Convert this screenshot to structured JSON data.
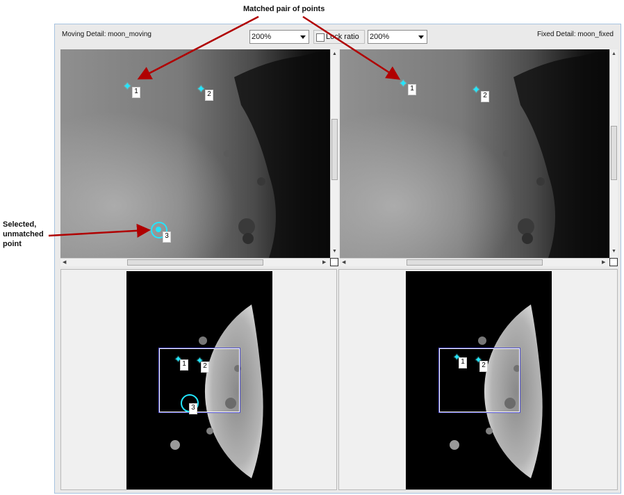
{
  "callouts": {
    "matched": "Matched pair of points",
    "selected_line1": "Selected,",
    "selected_line2": "unmatched",
    "selected_line3": "point"
  },
  "toolbar": {
    "moving_detail_label": "Moving Detail: moon_moving",
    "fixed_detail_label": "Fixed Detail: moon_fixed",
    "moving_zoom": "200%",
    "fixed_zoom": "200%",
    "lock_ratio_label": "Lock ratio",
    "lock_ratio_checked": false
  },
  "points": {
    "p1": "1",
    "p2": "2",
    "p3": "3"
  },
  "colors": {
    "point_color": "#22e6ff",
    "arrow_color": "#b00000",
    "viewport_rect_color": "#5050d0"
  }
}
